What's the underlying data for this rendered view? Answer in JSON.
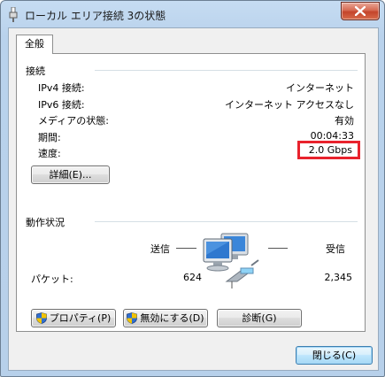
{
  "window": {
    "title": "ローカル エリア接続 3の状態",
    "close_icon": "close-icon"
  },
  "tabs": [
    {
      "label": "全般",
      "selected": true
    }
  ],
  "connection": {
    "header": "接続",
    "rows": [
      {
        "label": "IPv4 接続:",
        "value": "インターネット"
      },
      {
        "label": "IPv6 接続:",
        "value": "インターネット アクセスなし"
      },
      {
        "label": "メディアの状態:",
        "value": "有効"
      },
      {
        "label": "期間:",
        "value": "00:04:33"
      },
      {
        "label": "速度:",
        "value": "2.0 Gbps",
        "highlighted": true,
        "highlight_color": "#e8222d"
      }
    ],
    "details_button": "詳細(E)..."
  },
  "activity": {
    "header": "動作状況",
    "sent_label": "送信",
    "received_label": "受信",
    "packets_label": "パケット:",
    "packets_sent": "624",
    "packets_received": "2,345",
    "icon": "network-computers-icon"
  },
  "buttons": {
    "properties": "プロパティ(P)",
    "disable": "無効にする(D)",
    "diagnose": "診断(G)",
    "close": "閉じる(C)"
  },
  "colors": {
    "highlight": "#e8222d",
    "title_bar": "#b9d2ec",
    "shield_blue": "#2f6fd1",
    "shield_yellow": "#f2c300"
  }
}
